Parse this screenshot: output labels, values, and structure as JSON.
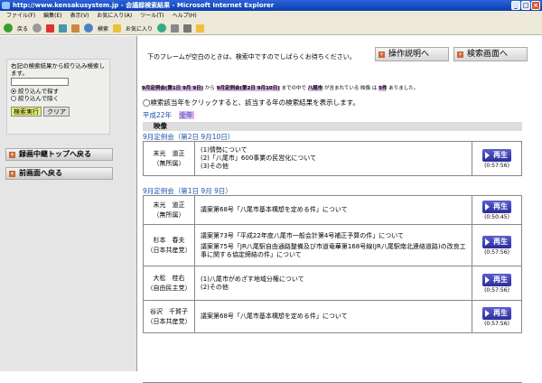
{
  "window": {
    "title": "http://www.kensakusystem.jp - 会議録検索結果 - Microsoft Internet Explorer"
  },
  "menu": [
    "ファイル(F)",
    "編集(E)",
    "表示(V)",
    "お気に入り(A)",
    "ツール(T)",
    "ヘルプ(H)"
  ],
  "toolbar": {
    "back": "戻る",
    "search": "検索",
    "favorites": "お気に入り"
  },
  "left": {
    "instruction": "右記の検索結果から絞り込み検索します。",
    "search_value": "",
    "radio_include": "絞り込んで探す",
    "radio_exclude": "絞り込んで除く",
    "exec_label": "検索実行",
    "clear_label": "クリア",
    "top_link": "録画中継トップへ戻る",
    "back_link": "前画面へ戻る"
  },
  "right": {
    "frame_note": "下のフレームが空白のときは、検索中ですのでしばらくお待ちください。",
    "help_button": "操作説明へ",
    "search_button": "検索画面へ",
    "cond": {
      "from": "9月定例会(第1日 9月 9日)",
      "w1": "から",
      "to": "9月定例会(第2日 9月10日)",
      "w2": "までの中で",
      "keyword": "八尾市",
      "w3": "が含まれている 映像 は",
      "count": "5件",
      "w4": "ありました。"
    },
    "note": "◯検索該当年をクリックすると、該当する年の検索結果を表示します。",
    "year": "平成22年",
    "all": "全年",
    "eizo": "映像",
    "sections": [
      {
        "title": "9月定例会（第2日 9月10日）",
        "rows": [
          {
            "speaker": [
              "末光　道正",
              "（無所属）"
            ],
            "lines": [
              "(1)情勢について",
              "(2)「八尾市」600事業の民営化について",
              "(3)その他"
            ],
            "play": "再生",
            "dur": "(0:57:56)"
          }
        ]
      },
      {
        "title": "9月定例会（第1日 9月 9日）",
        "rows": [
          {
            "speaker": [
              "末光　道正",
              "（無所属）"
            ],
            "lines": [
              "議案第68号「八尾市基本構想を定める件」について"
            ],
            "play": "再生",
            "dur": "(0:50:45)"
          },
          {
            "speaker": [
              "杉本　春夫",
              "（日本共産党）"
            ],
            "lines": [
              "議案第73号「平成22年度八尾市一般会計第4号補正予算の件」について",
              "議案第75号「JR八尾駅自由通路整備及び市道竜華第168号線(JR八尾駅南北連絡道路)の改良工事に関する協定締結の件」について"
            ],
            "play": "再生",
            "dur": "(0:57:56)"
          },
          {
            "speaker": [
              "大松　桂右",
              "（自由民主党）"
            ],
            "lines": [
              "(1)八尾市がめざす地域分権について",
              "(2)その他"
            ],
            "play": "再生",
            "dur": "(0:57:56)"
          },
          {
            "speaker": [
              "谷沢　千賀子",
              "（日本共産党）"
            ],
            "lines": [
              "議案第68号「八尾市基本構想を定める件」について"
            ],
            "play": "再生",
            "dur": "(0:57:56)"
          }
        ]
      }
    ]
  }
}
